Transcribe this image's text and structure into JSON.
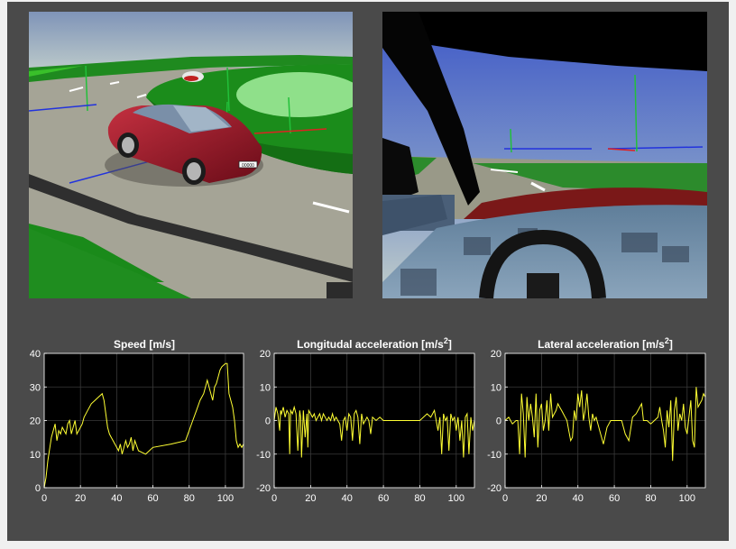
{
  "views": [
    {
      "name": "external-view",
      "plate_text": "00000"
    },
    {
      "name": "driver-view"
    }
  ],
  "colors": {
    "background": "#4a4a4a",
    "plot_bg": "#000000",
    "axis": "#ffffff",
    "grid": "#3a3a3a",
    "line": "#ffff33"
  },
  "chart_data": [
    {
      "type": "line",
      "title": "Speed [m/s]",
      "xlabel": "",
      "ylabel": "",
      "xlim": [
        0,
        110
      ],
      "ylim": [
        0,
        40
      ],
      "xticks": [
        0,
        20,
        40,
        60,
        80,
        100
      ],
      "yticks": [
        0,
        10,
        20,
        30,
        40
      ],
      "grid": true,
      "x": [
        0,
        1,
        2,
        4,
        6,
        7,
        8,
        9,
        10,
        11,
        12,
        13,
        14,
        15,
        16,
        17,
        18,
        19,
        20,
        21,
        22,
        24,
        26,
        28,
        30,
        32,
        33,
        34,
        35,
        36,
        37,
        38,
        39,
        40,
        41,
        42,
        43,
        44,
        45,
        46,
        47,
        48,
        49,
        50,
        52,
        56,
        60,
        70,
        78,
        80,
        82,
        84,
        86,
        88,
        90,
        91,
        92,
        93,
        94,
        95,
        96,
        97,
        98,
        100,
        101,
        102,
        103,
        104,
        105,
        106,
        107,
        108,
        109,
        110
      ],
      "y": [
        0,
        3,
        8,
        15,
        19,
        14,
        17,
        16,
        18,
        17,
        16,
        19,
        20,
        16,
        18,
        20,
        16,
        17,
        18,
        19,
        21,
        23,
        25,
        26,
        27,
        28,
        26,
        22,
        18,
        16,
        15,
        14,
        13,
        12,
        11,
        13,
        10,
        12,
        14,
        12,
        13,
        15,
        11,
        14,
        11,
        10,
        12,
        13,
        14,
        17,
        20,
        23,
        26,
        28,
        32,
        30,
        28,
        26,
        30,
        31,
        33,
        35,
        36,
        37,
        37,
        28,
        26,
        24,
        20,
        14,
        12,
        13,
        12,
        13
      ]
    },
    {
      "type": "line",
      "title": "Longitudal acceleration [m/s",
      "title_sup": "2",
      "title_end": "]",
      "xlabel": "",
      "ylabel": "",
      "xlim": [
        0,
        110
      ],
      "ylim": [
        -20,
        20
      ],
      "xticks": [
        0,
        20,
        40,
        60,
        80,
        100
      ],
      "yticks": [
        -20,
        -10,
        0,
        10,
        20
      ],
      "grid": true,
      "x": [
        0,
        1,
        2,
        3,
        3.5,
        4,
        5,
        6,
        7,
        8,
        8.5,
        9,
        10,
        11,
        12,
        13,
        14,
        14.5,
        15,
        16,
        17,
        18,
        18.5,
        19,
        20,
        21,
        22,
        23,
        24,
        25,
        26,
        27,
        28,
        29,
        30,
        31,
        32,
        33,
        34,
        35,
        36,
        37,
        38,
        39,
        40,
        41,
        42,
        43,
        44,
        45,
        46,
        47,
        48,
        49,
        50,
        51,
        52,
        53,
        54,
        56,
        58,
        60,
        65,
        70,
        75,
        78,
        80,
        82,
        84,
        86,
        87,
        88,
        89,
        90,
        91,
        92,
        93,
        94,
        95,
        96,
        97,
        98,
        99,
        100,
        101,
        102,
        103,
        104,
        105,
        106,
        107,
        108,
        109,
        110
      ],
      "y": [
        0,
        4,
        2,
        -3,
        3,
        2,
        4,
        1,
        3,
        2,
        -10,
        3,
        2,
        4,
        2,
        -9,
        3,
        1,
        -11,
        3,
        -5,
        2,
        -8,
        3,
        2,
        1,
        2,
        0,
        1,
        2,
        0,
        2,
        1,
        0,
        1,
        0,
        2,
        0,
        1,
        0,
        -1,
        -6,
        0,
        1,
        -3,
        2,
        1,
        -6,
        2,
        3,
        1,
        -7,
        2,
        -1,
        0,
        1,
        0,
        -4,
        1,
        0,
        1,
        0,
        0,
        0,
        0,
        0,
        0,
        1,
        2,
        1,
        2,
        3,
        0,
        -3,
        1,
        -10,
        2,
        0,
        1,
        -9,
        2,
        0,
        1,
        -3,
        1,
        -6,
        0,
        -11,
        1,
        2,
        -10,
        1,
        -3,
        0
      ]
    },
    {
      "type": "line",
      "title": "Lateral acceleration [m/s",
      "title_sup": "2",
      "title_end": "]",
      "xlabel": "",
      "ylabel": "",
      "xlim": [
        0,
        110
      ],
      "ylim": [
        -20,
        20
      ],
      "xticks": [
        0,
        20,
        40,
        60,
        80,
        100
      ],
      "yticks": [
        -20,
        -10,
        0,
        10,
        20
      ],
      "grid": true,
      "x": [
        0,
        2,
        4,
        6,
        7,
        8,
        9,
        10,
        11,
        12,
        13,
        14,
        15,
        16,
        17,
        18,
        19,
        20,
        21,
        22,
        23,
        24,
        25,
        26,
        27,
        28,
        29,
        30,
        31,
        32,
        33,
        34,
        35,
        36,
        37,
        38,
        39,
        40,
        41,
        42,
        43,
        44,
        45,
        46,
        47,
        48,
        49,
        50,
        52,
        54,
        56,
        58,
        60,
        62,
        64,
        66,
        68,
        70,
        72,
        74,
        75,
        76,
        78,
        80,
        82,
        84,
        85,
        86,
        87,
        88,
        89,
        90,
        91,
        92,
        93,
        94,
        95,
        96,
        97,
        98,
        99,
        100,
        101,
        102,
        103,
        104,
        105,
        106,
        107,
        108,
        109,
        110
      ],
      "y": [
        0,
        1,
        -1,
        0,
        0,
        -10,
        8,
        2,
        -11,
        7,
        0,
        5,
        1,
        -5,
        8,
        -8,
        3,
        5,
        -3,
        0,
        6,
        -3,
        8,
        1,
        2,
        3,
        5,
        4,
        3,
        2,
        1,
        0,
        -3,
        -6,
        -5,
        3,
        0,
        8,
        4,
        9,
        0,
        3,
        8,
        1,
        -3,
        2,
        0,
        1,
        -3,
        -7,
        -2,
        0,
        0,
        0,
        0,
        -4,
        -6,
        1,
        2,
        4,
        5,
        0,
        0,
        -1,
        0,
        1,
        4,
        0,
        -3,
        -8,
        3,
        -2,
        6,
        -12,
        3,
        7,
        -3,
        2,
        0,
        5,
        -2,
        -4,
        1,
        6,
        -6,
        -8,
        10,
        4,
        5,
        6,
        8,
        7
      ]
    }
  ]
}
